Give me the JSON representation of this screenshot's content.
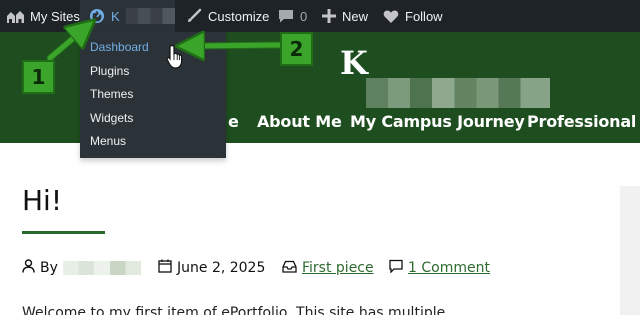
{
  "admin_bar": {
    "my_sites": "My Sites",
    "site_initial": "K",
    "customize": "Customize",
    "comments_count": "0",
    "new": "New",
    "follow": "Follow"
  },
  "site_menu": {
    "items": [
      {
        "label": "Dashboard",
        "active": true
      },
      {
        "label": "Plugins",
        "active": false
      },
      {
        "label": "Themes",
        "active": false
      },
      {
        "label": "Widgets",
        "active": false
      },
      {
        "label": "Menus",
        "active": false
      }
    ]
  },
  "header": {
    "site_title_initial": "K",
    "nav": {
      "home_fragment": "e",
      "about": "About Me",
      "journey": "My Campus Journey",
      "professional": "Professional"
    }
  },
  "post": {
    "title": "Hi!",
    "by": "By",
    "date": "June 2, 2025",
    "category": "First piece",
    "comments": "1 Comment",
    "excerpt": "Welcome to my first item of ePortfolio. This site has multiple"
  },
  "annotations": {
    "callout_1": "1",
    "callout_2": "2"
  },
  "colors": {
    "admin_bar_bg": "#1d2327",
    "submenu_bg": "#2c3338",
    "admin_link_active": "#72aee6",
    "header_green": "#1e4d1f",
    "link_green": "#2e6b2f",
    "annotation_green": "#3aa52a"
  }
}
